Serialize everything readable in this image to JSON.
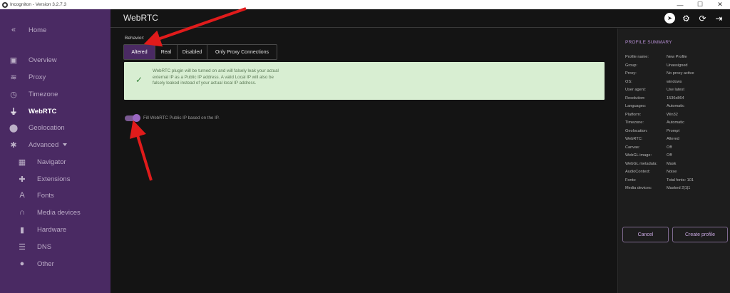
{
  "window": {
    "title": "Incogniton - Version 3.2.7.3",
    "controls": [
      "—",
      "☐",
      "✕"
    ]
  },
  "sidebar": {
    "items": [
      {
        "label": "Home",
        "icon": "double-chevron-left-icon",
        "glyph": "«"
      },
      {
        "label": "Overview",
        "icon": "id-card-icon",
        "glyph": "▣"
      },
      {
        "label": "Proxy",
        "icon": "wifi-icon",
        "glyph": "≋"
      },
      {
        "label": "Timezone",
        "icon": "clock-icon",
        "glyph": "◷"
      },
      {
        "label": "WebRTC",
        "icon": "plug-icon",
        "glyph": "⏚"
      },
      {
        "label": "Geolocation",
        "icon": "map-pin-icon",
        "glyph": "⬤"
      },
      {
        "label": "Advanced",
        "icon": "asterisk-icon",
        "glyph": "✱"
      },
      {
        "label": "Navigator",
        "icon": "map-icon",
        "glyph": "▦"
      },
      {
        "label": "Extensions",
        "icon": "puzzle-icon",
        "glyph": "✚"
      },
      {
        "label": "Fonts",
        "icon": "font-icon",
        "glyph": "A"
      },
      {
        "label": "Media devices",
        "icon": "headphones-icon",
        "glyph": "∩"
      },
      {
        "label": "Hardware",
        "icon": "chip-icon",
        "glyph": "▮"
      },
      {
        "label": "DNS",
        "icon": "server-icon",
        "glyph": "☰"
      },
      {
        "label": "Other",
        "icon": "settings-icon",
        "glyph": "●"
      }
    ]
  },
  "header": {
    "title": "WebRTC",
    "icons": [
      {
        "name": "telegram-icon",
        "glyph": "➤"
      },
      {
        "name": "gear-icon",
        "glyph": "⚙"
      },
      {
        "name": "refresh-icon",
        "glyph": "⟳"
      },
      {
        "name": "logout-icon",
        "glyph": "⇥"
      }
    ]
  },
  "main": {
    "behavior_label": "Behavior:",
    "behavior_options": [
      "Altered",
      "Real",
      "Disabled",
      "Only Proxy Connections"
    ],
    "behavior_selected": "Altered",
    "alert_text": "WebRTC plugin will be turned on and will falsely leak your actual external IP as a Public IP address. A valid Local IP will also be falsely leaked instead of your actual local IP address.",
    "toggle_label": "Fill WebRTC Public IP based on the IP.",
    "toggle_on": true
  },
  "summary": {
    "title": "PROFILE SUMMARY",
    "rows": [
      {
        "key": "Profile name:",
        "value": "New Profile"
      },
      {
        "key": "Group:",
        "value": "Unassigned"
      },
      {
        "key": "Proxy:",
        "value": "No proxy active"
      },
      {
        "key": "OS:",
        "value": "windows"
      },
      {
        "key": "User agent:",
        "value": "Use latest"
      },
      {
        "key": "Resolution:",
        "value": "1536x864"
      },
      {
        "key": "Languages:",
        "value": "Automatic"
      },
      {
        "key": "Platform:",
        "value": "Win32"
      },
      {
        "key": "Timezone:",
        "value": "Automatic"
      },
      {
        "key": "Geolocation:",
        "value": "Prompt"
      },
      {
        "key": "WebRTC:",
        "value": "Altered"
      },
      {
        "key": "Canvas:",
        "value": "Off"
      },
      {
        "key": "WebGL image:",
        "value": "Off"
      },
      {
        "key": "WebGL metadata:",
        "value": "Mask"
      },
      {
        "key": "AudioContext:",
        "value": "Noise"
      },
      {
        "key": "Fonts:",
        "value": "Total fonts: 101"
      },
      {
        "key": "Media devices:",
        "value": "Masked 2|1|1"
      }
    ],
    "cancel_label": "Cancel",
    "create_label": "Create profile"
  },
  "colors": {
    "sidebar_bg": "#4a2a63",
    "accent": "#9a67c2",
    "alert_bg": "#d8eed2",
    "annotation_arrow": "#e01b1b"
  }
}
